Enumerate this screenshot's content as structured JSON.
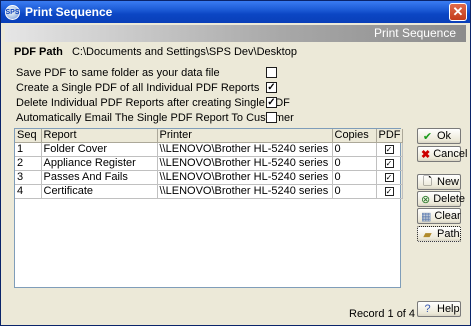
{
  "window": {
    "title": "Print Sequence",
    "banner": "Print Sequence"
  },
  "pdf_path": {
    "label": "PDF Path",
    "value": "C:\\Documents and Settings\\SPS Dev\\Desktop"
  },
  "options": [
    {
      "label": "Save PDF to same folder as your data file",
      "checked": false
    },
    {
      "label": "Create a Single PDF of all Individual PDF Reports",
      "checked": true
    },
    {
      "label": "Delete Individual PDF Reports after creating Single PDF",
      "checked": true
    },
    {
      "label": "Automatically Email The Single PDF Report To Customer",
      "checked": false
    }
  ],
  "grid": {
    "columns": [
      "Seq",
      "Report",
      "Printer",
      "Copies",
      "PDF"
    ],
    "rows": [
      {
        "seq": "1",
        "report": "Folder Cover",
        "printer": "\\\\LENOVO\\Brother HL-5240 series",
        "copies": "0",
        "pdf": true
      },
      {
        "seq": "2",
        "report": "Appliance Register",
        "printer": "\\\\LENOVO\\Brother HL-5240 series",
        "copies": "0",
        "pdf": true
      },
      {
        "seq": "3",
        "report": "Passes And Fails",
        "printer": "\\\\LENOVO\\Brother HL-5240 series",
        "copies": "0",
        "pdf": true
      },
      {
        "seq": "4",
        "report": "Certificate",
        "printer": "\\\\LENOVO\\Brother HL-5240 series",
        "copies": "0",
        "pdf": true
      }
    ]
  },
  "buttons": {
    "ok": "Ok",
    "cancel": "Cancel",
    "new": "New",
    "delete": "Delete",
    "clear": "Clear",
    "path": "Path",
    "help": "Help"
  },
  "status": "Record 1 of 4",
  "colors": {
    "title_bar": "#0a3fb8",
    "check": "#000000",
    "cancel_icon": "#cc0000",
    "ok_icon": "#1a9a1a"
  }
}
